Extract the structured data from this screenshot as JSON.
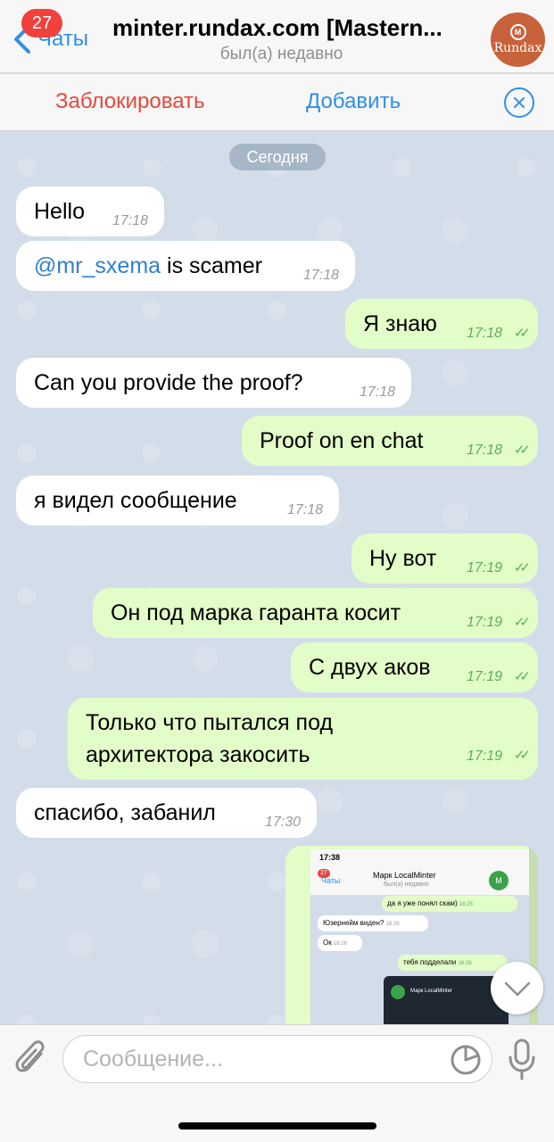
{
  "header": {
    "back_label": "Чаты",
    "unread_badge": "27",
    "title": "minter.rundax.com [Mastern...",
    "subtitle": "был(а) недавно",
    "avatar_text": "Rundax",
    "avatar_mark": "M"
  },
  "actions": {
    "block_label": "Заблокировать",
    "add_label": "Добавить"
  },
  "chat": {
    "date_label": "Сегодня",
    "messages": [
      {
        "dir": "in",
        "text": "Hello",
        "time": "17:18"
      },
      {
        "dir": "in",
        "mention": "@mr_sxema",
        "text": " is scamer",
        "time": "17:18"
      },
      {
        "dir": "out",
        "text": "Я знаю",
        "time": "17:18"
      },
      {
        "dir": "in",
        "text": "Can you provide the proof?",
        "time": "17:18"
      },
      {
        "dir": "out",
        "text": "Proof on en chat",
        "time": "17:18"
      },
      {
        "dir": "in",
        "text": "я видел сообщение",
        "time": "17:18"
      },
      {
        "dir": "out",
        "text": "Ну вот",
        "time": "17:19"
      },
      {
        "dir": "out",
        "text": "Он под марка гаранта косит",
        "time": "17:19"
      },
      {
        "dir": "out",
        "text": "С двух аков",
        "time": "17:19"
      },
      {
        "dir": "out",
        "text": "Только что пытался под архитектора закосить",
        "time": "17:19"
      },
      {
        "dir": "in",
        "text": "спасибо, забанил",
        "time": "17:30"
      }
    ],
    "screenshot": {
      "status_time": "17:38",
      "badge": "27",
      "back_label": "Чаты",
      "title": "Марк LocalMinter",
      "subtitle": "был(а) недавно",
      "msg1": "да я уже понял скам)",
      "msg1_time": "16:25",
      "msg2": "Юзернейм виден?",
      "msg2_time": "16:26",
      "msg3": "Ок",
      "msg3_time": "16:26",
      "msg4": "тебя подделали",
      "msg4_time": "16:26",
      "inner_title": "Марк LocalMinter"
    }
  },
  "input": {
    "placeholder": "Сообщение..."
  },
  "colors": {
    "accent": "#2f8fe6",
    "danger": "#e4483e",
    "outgoing_bubble": "#e2fdc8",
    "incoming_bubble": "#ffffff",
    "chat_bg": "#d3dde9"
  }
}
